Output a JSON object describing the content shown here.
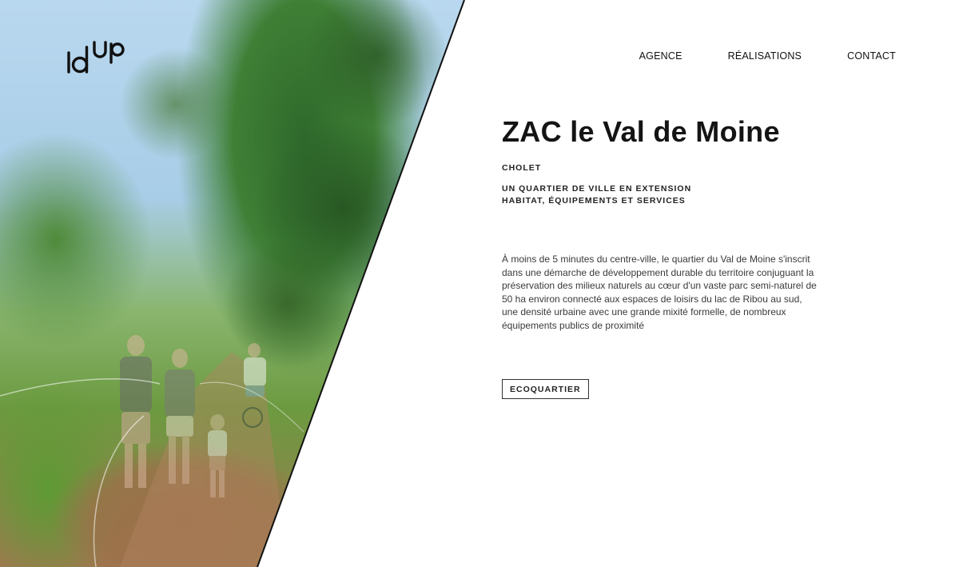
{
  "brand": {
    "logo_text": "idup"
  },
  "nav": {
    "items": [
      {
        "label": "AGENCE"
      },
      {
        "label": "RÉALISATIONS"
      },
      {
        "label": "CONTACT"
      }
    ]
  },
  "project": {
    "title": "ZAC le Val de Moine",
    "city": "CHOLET",
    "subtitle_line1": "UN QUARTIER DE VILLE EN EXTENSION",
    "subtitle_line2": "HABITAT, ÉQUIPEMENTS ET SERVICES",
    "description": "À moins de 5 minutes du centre-ville, le quartier du Val de Moine s'inscrit dans une démarche de développement durable du territoire conjuguant la préservation des milieux naturels au cœur d'un vaste parc semi-naturel de 50 ha environ connecté aux espaces de loisirs du lac de Ribou au sud, une densité urbaine avec une grande mixité formelle, de nombreux équipements publics de proximité",
    "tag": "ECOQUARTIER"
  },
  "colors": {
    "text": "#111111",
    "background": "#ffffff"
  }
}
